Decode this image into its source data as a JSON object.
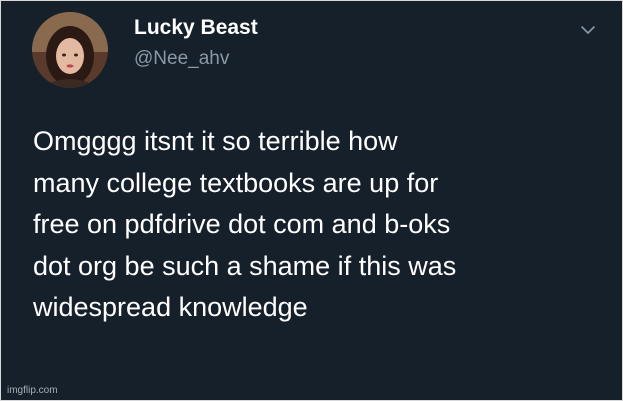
{
  "tweet": {
    "display_name": "Lucky Beast",
    "handle": "@Nee_ahv",
    "menu_icon": "chevron-down-icon",
    "avatar_icon": "user-avatar",
    "text_lines": [
      "Omgggg itsnt it so terrible how",
      "many college textbooks are up for",
      "free on pdfdrive dot com and b-oks",
      "dot org be such a shame if this was",
      "widespread knowledge"
    ]
  },
  "watermark": "imgflip.com",
  "colors": {
    "background": "#15202b",
    "text": "#ffffff",
    "secondary_text": "#8b98a5"
  }
}
